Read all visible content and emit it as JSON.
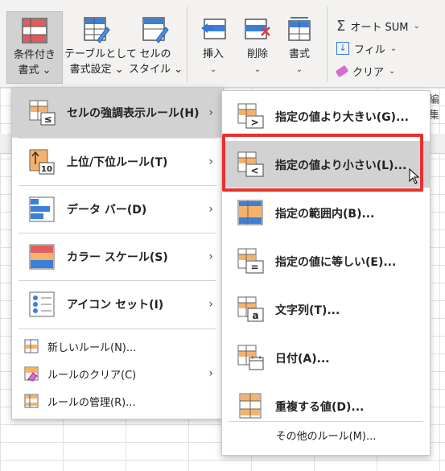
{
  "ribbon": {
    "conditional_formatting": {
      "line1": "条件付き",
      "line2": "書式 ⌄"
    },
    "format_as_table": {
      "line1": "テーブルとして",
      "line2": "書式設定 ⌄"
    },
    "cell_styles": {
      "line1": "セルの",
      "line2": "スタイル ⌄"
    },
    "insert": {
      "label": "挿入",
      "chevron": "⌄"
    },
    "delete": {
      "label": "削除",
      "chevron": "⌄"
    },
    "format": {
      "label": "書式",
      "chevron": "⌄"
    },
    "autosum": "オート SUM",
    "fill": "フィル",
    "clear": "クリア",
    "editing_group": "編集"
  },
  "main_menu": {
    "items": [
      {
        "label": "セルの強調表示ルール(H)",
        "icon": "highlight-rules-icon"
      },
      {
        "label": "上位/下位ルール(T)",
        "icon": "top-bottom-icon"
      },
      {
        "label": "データ バー(D)",
        "icon": "data-bar-icon"
      },
      {
        "label": "カラー スケール(S)",
        "icon": "color-scale-icon"
      },
      {
        "label": "アイコン セット(I)",
        "icon": "icon-set-icon"
      }
    ],
    "small_items": [
      {
        "label": "新しいルール(N)...",
        "icon": "new-rule-icon"
      },
      {
        "label": "ルールのクリア(C)",
        "icon": "clear-rules-icon"
      },
      {
        "label": "ルールの管理(R)...",
        "icon": "manage-rules-icon"
      }
    ]
  },
  "sub_menu": {
    "items": [
      {
        "label": "指定の値より大きい(G)...",
        "icon": "greater-than-icon"
      },
      {
        "label": "指定の値より小さい(L)...",
        "icon": "less-than-icon"
      },
      {
        "label": "指定の範囲内(B)...",
        "icon": "between-icon"
      },
      {
        "label": "指定の値に等しい(E)...",
        "icon": "equal-to-icon"
      },
      {
        "label": "文字列(T)...",
        "icon": "text-contains-icon"
      },
      {
        "label": "日付(A)...",
        "icon": "date-occurring-icon"
      },
      {
        "label": "重複する値(D)...",
        "icon": "duplicate-values-icon"
      }
    ],
    "more_rules": "その他のルール(M)..."
  },
  "colors": {
    "highlight": "#d2d2d2",
    "annotation_red": "#e8312f",
    "orange": "#f6b26b",
    "blue": "#2f7bd4"
  }
}
